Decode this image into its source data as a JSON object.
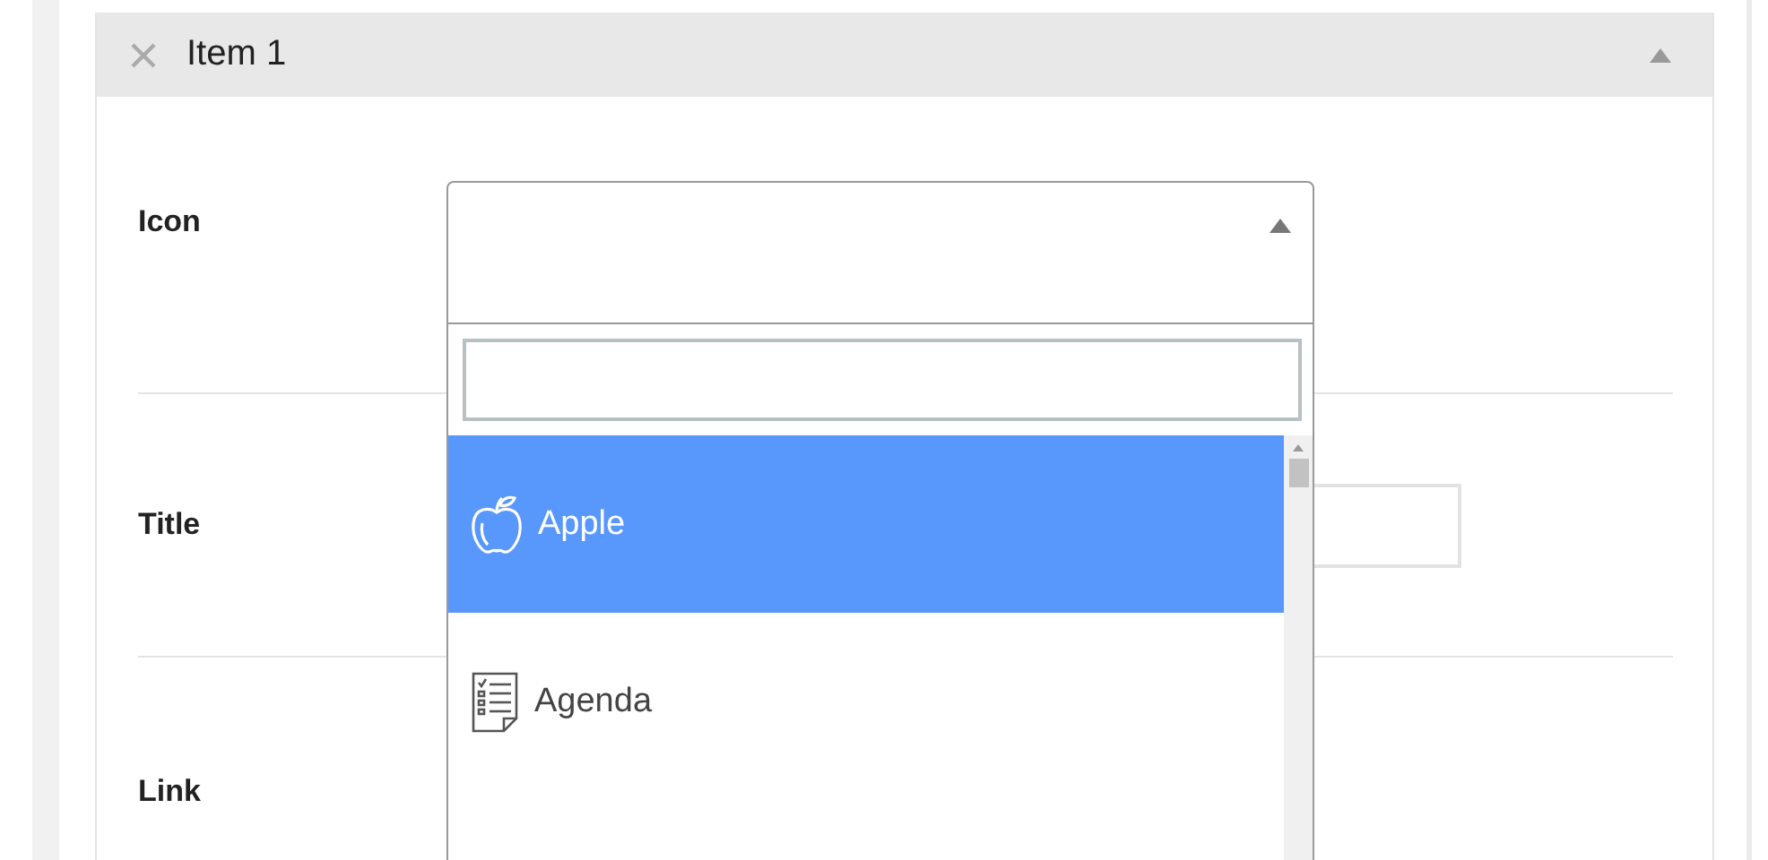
{
  "panel": {
    "title": "Item 1",
    "expanded": true
  },
  "fields": [
    {
      "label": "Icon",
      "kind": "select"
    },
    {
      "label": "Title",
      "kind": "text"
    },
    {
      "label": "Link",
      "kind": "plain"
    }
  ],
  "dropdown": {
    "options": [
      {
        "label": "Apple",
        "selected": true
      },
      {
        "label": "Agenda",
        "selected": false
      }
    ]
  }
}
